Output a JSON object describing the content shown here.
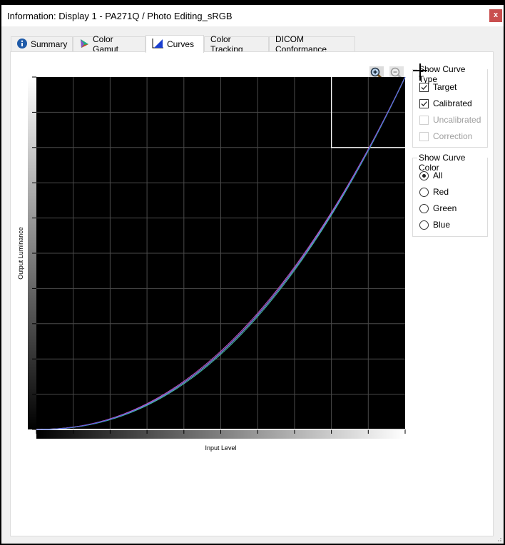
{
  "window": {
    "title": "Information: Display 1 - PA271Q / Photo Editing_sRGB",
    "close_label": "x"
  },
  "tabs": [
    {
      "label": "Summary",
      "icon": "info-icon",
      "active": false
    },
    {
      "label": "Color Gamut",
      "icon": "color-gamut-icon",
      "active": false
    },
    {
      "label": "Curves",
      "icon": "curves-icon",
      "active": true
    },
    {
      "label": "Color Tracking",
      "icon": "",
      "active": false
    },
    {
      "label": "DICOM Conformance",
      "icon": "",
      "active": false
    }
  ],
  "toolbar": {
    "zoom_in_icon": "zoom-in-icon",
    "zoom_out_icon": "zoom-out-icon",
    "zoom_out_enabled": false
  },
  "curve_type": {
    "title": "Show Curve Type",
    "options": [
      {
        "label": "Target",
        "checked": true,
        "enabled": true
      },
      {
        "label": "Calibrated",
        "checked": true,
        "enabled": true
      },
      {
        "label": "Uncalibrated",
        "checked": false,
        "enabled": false
      },
      {
        "label": "Correction",
        "checked": false,
        "enabled": false
      }
    ]
  },
  "curve_color": {
    "title": "Show Curve Color",
    "options": [
      {
        "label": "All",
        "selected": true
      },
      {
        "label": "Red",
        "selected": false
      },
      {
        "label": "Green",
        "selected": false
      },
      {
        "label": "Blue",
        "selected": false
      }
    ]
  },
  "chart_data": {
    "type": "line",
    "title": "",
    "xlabel": "Input Level",
    "ylabel": "Output Luminance",
    "xlim": [
      0,
      1
    ],
    "ylim": [
      0,
      1
    ],
    "grid": true,
    "grid_divisions": 10,
    "background": "#000000",
    "gamma": 2.2,
    "series": [
      {
        "name": "Target",
        "color": "#ffffff",
        "gamma": 2.2
      },
      {
        "name": "Calibrated Red",
        "color": "#c050c0",
        "gamma": 2.17
      },
      {
        "name": "Calibrated Green",
        "color": "#40c0a0",
        "gamma": 2.23
      },
      {
        "name": "Calibrated Blue",
        "color": "#5060e0",
        "gamma": 2.2
      }
    ],
    "zoom_box": {
      "x": [
        0.8,
        1.0
      ],
      "y": [
        0.8,
        1.0
      ]
    }
  }
}
